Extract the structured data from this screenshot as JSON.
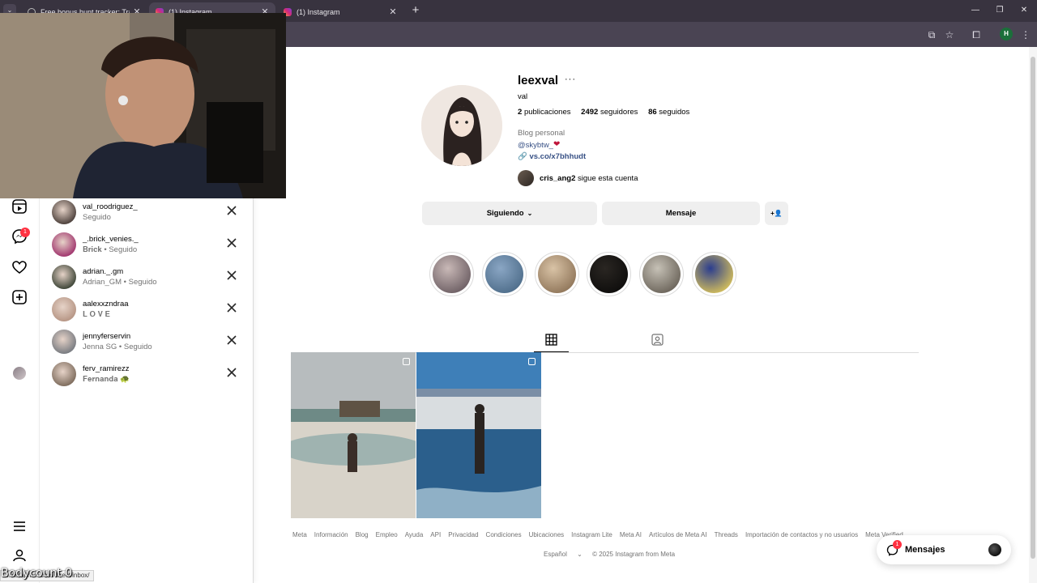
{
  "browser": {
    "tabs": [
      {
        "title": "Free bonus hunt tracker: Track y",
        "active": false
      },
      {
        "title": "(1) Instagram",
        "active": true
      },
      {
        "title": "(1) Instagram",
        "active": false
      }
    ],
    "new_tab": "+",
    "status_url": "...instagram.com/direct/inbox/"
  },
  "leftnav": {
    "badge": "1",
    "icons": [
      "reels-icon",
      "messenger-icon",
      "heart-icon",
      "create-icon",
      "profile-avatar",
      "menu-icon",
      "threads-icon"
    ]
  },
  "following_list": [
    {
      "username": "val_roodriguez_",
      "subtitle": "Seguido",
      "serif": false,
      "avatar": "#4b3f3a"
    },
    {
      "username": "_.brick_venies._",
      "subtitle": "𝐁𝐫𝐢𝐜𝐤 • Seguido",
      "serif": false,
      "avatar": "#a0346d"
    },
    {
      "username": "adrian._.gm",
      "subtitle": "Adrian_GM • Seguido",
      "serif": false,
      "avatar": "#3c4436"
    },
    {
      "username": "aalexxzndraa",
      "subtitle": "𝐋 𝐎 𝐕 𝐄",
      "serif": false,
      "avatar": "#b69584"
    },
    {
      "username": "jennyferservin",
      "subtitle": "Jenna SG • Seguido",
      "serif": false,
      "avatar": "#777a80"
    },
    {
      "username": "ferv_ramirezz",
      "subtitle": "𝐅𝐞𝐫𝐧𝐚𝐧𝐝𝐚 🐢",
      "serif": false,
      "avatar": "#7d6b5c"
    }
  ],
  "profile": {
    "username": "leexval",
    "more": "···",
    "full_name": "val",
    "posts_count": "2",
    "posts_label": "publicaciones",
    "followers_count": "2492",
    "followers_label": "seguidores",
    "following_count": "86",
    "following_label": "seguidos",
    "category": "Blog personal",
    "mention": "@skybtw_",
    "link": "vs.co/x7bhhudt",
    "followed_by_user": "cris_ang2",
    "followed_by_text": "sigue esta cuenta",
    "btn_following": "Siguiendo",
    "btn_message": "Mensaje",
    "btn_suggest": "+👤"
  },
  "highlights": [
    {
      "color_a": "#c9b9b7",
      "color_b": "#6c5e63"
    },
    {
      "color_a": "#8aa6c4",
      "color_b": "#4e6d8a"
    },
    {
      "color_a": "#d9c3a6",
      "color_b": "#8f7559"
    },
    {
      "color_a": "#2a2622",
      "color_b": "#0e0d0c"
    },
    {
      "color_a": "#c6c1b6",
      "color_b": "#6a6359"
    },
    {
      "color_a": "#2b3d8f",
      "color_b": "#d7c15a"
    }
  ],
  "footer": {
    "links": [
      "Meta",
      "Información",
      "Blog",
      "Empleo",
      "Ayuda",
      "API",
      "Privacidad",
      "Condiciones",
      "Ubicaciones",
      "Instagram Lite",
      "Meta AI",
      "Artículos de Meta AI",
      "Threads",
      "Importación de contactos y no usuarios",
      "Meta Verified"
    ],
    "language": "Español",
    "copyright": "© 2025 Instagram from Meta"
  },
  "messages_pill": {
    "label": "Mensajes",
    "badge": "1"
  },
  "overlay_text": "Bodycount 0",
  "colors": {
    "link": "#385185",
    "badge": "#ff3040",
    "button_bg": "#efefef",
    "chrome_dark": "#38333f"
  }
}
